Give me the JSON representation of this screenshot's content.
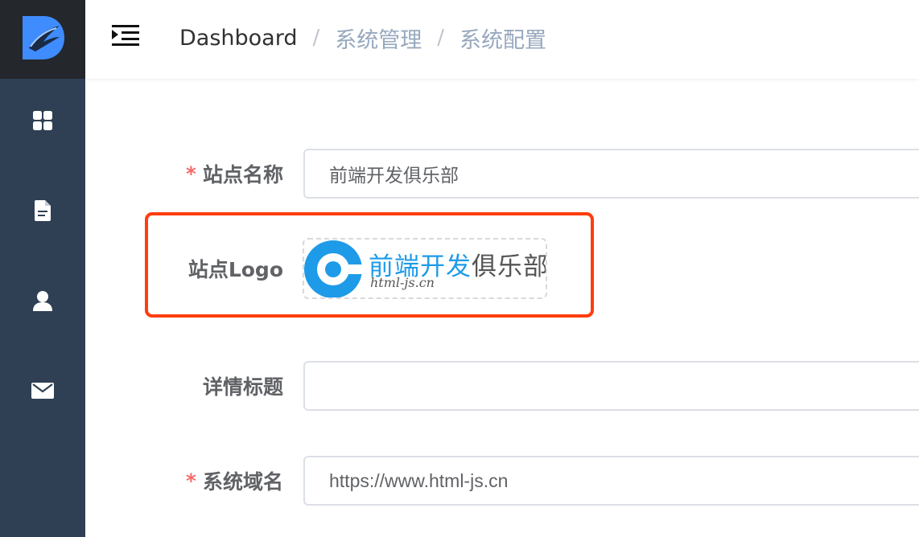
{
  "sidebar": {
    "logo": {
      "icon": "brand-d-logo-icon",
      "color": "#3f8cff"
    },
    "items": [
      {
        "icon": "dashboard-grid-icon"
      },
      {
        "icon": "document-icon"
      },
      {
        "icon": "user-icon"
      },
      {
        "icon": "mail-icon"
      }
    ]
  },
  "header": {
    "menu_icon": "menu-fold-icon",
    "breadcrumb": [
      "Dashboard",
      "系统管理",
      "系统配置"
    ],
    "separator": "/"
  },
  "form": {
    "required_mark": "*",
    "site_name": {
      "label": "站点名称",
      "value": "前端开发俱乐部",
      "required": true
    },
    "site_logo": {
      "label": "站点Logo",
      "image_text_blue": "前端开发",
      "image_text_gray": "俱乐部",
      "image_text_en": "html-js.cn",
      "brand_color": "#1e9be8"
    },
    "detail_title": {
      "label": "详情标题",
      "value": "",
      "required": false
    },
    "domain": {
      "label": "系统域名",
      "value": "https://www.html-js.cn",
      "required": true
    }
  },
  "colors": {
    "sidebar_bg": "#2f4054",
    "logo_bg": "#24272c",
    "highlight": "#ff3d0d",
    "required": "#f56c6c"
  }
}
